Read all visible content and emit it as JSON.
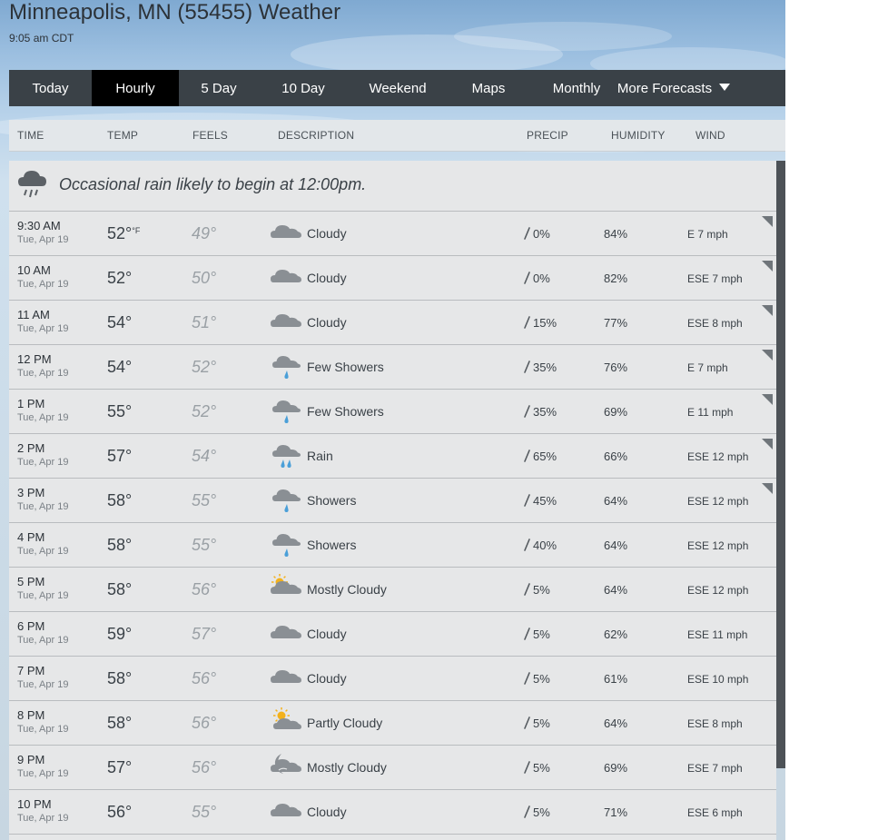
{
  "header": {
    "title": "Minneapolis, MN (55455) Weather",
    "time": "9:05 am CDT"
  },
  "nav": {
    "tabs": [
      {
        "label": "Today",
        "active": false
      },
      {
        "label": "Hourly",
        "active": true
      },
      {
        "label": "5 Day",
        "active": false
      },
      {
        "label": "10 Day",
        "active": false
      },
      {
        "label": "Weekend",
        "active": false
      },
      {
        "label": "Maps",
        "active": false
      },
      {
        "label": "Monthly",
        "active": false
      },
      {
        "label": "More Forecasts",
        "active": false,
        "dropdown": true
      }
    ]
  },
  "columns": {
    "time": "TIME",
    "temp": "TEMP",
    "feels": "FEELS",
    "description": "DESCRIPTION",
    "precip": "PRECIP",
    "humidity": "HUMIDITY",
    "wind": "WIND"
  },
  "banner": {
    "text": "Occasional rain likely to begin at 12:00pm.",
    "icon": "rain-cloud-icon"
  },
  "temp_unit": "°F",
  "rows": [
    {
      "time": "9:30 AM",
      "date": "Tue, Apr 19",
      "temp": "52°",
      "feels": "49°",
      "icon": "cloud-icon",
      "desc": "Cloudy",
      "precip": "0%",
      "humidity": "84%",
      "wind": "E 7 mph",
      "expandable": true
    },
    {
      "time": "10 AM",
      "date": "Tue, Apr 19",
      "temp": "52°",
      "feels": "50°",
      "icon": "cloud-icon",
      "desc": "Cloudy",
      "precip": "0%",
      "humidity": "82%",
      "wind": "ESE 7 mph",
      "expandable": true
    },
    {
      "time": "11 AM",
      "date": "Tue, Apr 19",
      "temp": "54°",
      "feels": "51°",
      "icon": "cloud-icon",
      "desc": "Cloudy",
      "precip": "15%",
      "humidity": "77%",
      "wind": "ESE 8 mph",
      "expandable": true
    },
    {
      "time": "12 PM",
      "date": "Tue, Apr 19",
      "temp": "54°",
      "feels": "52°",
      "icon": "showers-icon",
      "desc": "Few Showers",
      "precip": "35%",
      "humidity": "76%",
      "wind": "E 7 mph",
      "expandable": true
    },
    {
      "time": "1 PM",
      "date": "Tue, Apr 19",
      "temp": "55°",
      "feels": "52°",
      "icon": "showers-icon",
      "desc": "Few Showers",
      "precip": "35%",
      "humidity": "69%",
      "wind": "E 11 mph",
      "expandable": true
    },
    {
      "time": "2 PM",
      "date": "Tue, Apr 19",
      "temp": "57°",
      "feels": "54°",
      "icon": "rain-icon",
      "desc": "Rain",
      "precip": "65%",
      "humidity": "66%",
      "wind": "ESE 12 mph",
      "expandable": true
    },
    {
      "time": "3 PM",
      "date": "Tue, Apr 19",
      "temp": "58°",
      "feels": "55°",
      "icon": "showers-icon",
      "desc": "Showers",
      "precip": "45%",
      "humidity": "64%",
      "wind": "ESE 12 mph",
      "expandable": true
    },
    {
      "time": "4 PM",
      "date": "Tue, Apr 19",
      "temp": "58°",
      "feels": "55°",
      "icon": "showers-icon",
      "desc": "Showers",
      "precip": "40%",
      "humidity": "64%",
      "wind": "ESE 12 mph",
      "expandable": false
    },
    {
      "time": "5 PM",
      "date": "Tue, Apr 19",
      "temp": "58°",
      "feels": "56°",
      "icon": "mostly-cloudy-sun-icon",
      "desc": "Mostly Cloudy",
      "precip": "5%",
      "humidity": "64%",
      "wind": "ESE 12 mph",
      "expandable": false
    },
    {
      "time": "6 PM",
      "date": "Tue, Apr 19",
      "temp": "59°",
      "feels": "57°",
      "icon": "cloud-icon",
      "desc": "Cloudy",
      "precip": "5%",
      "humidity": "62%",
      "wind": "ESE 11 mph",
      "expandable": false
    },
    {
      "time": "7 PM",
      "date": "Tue, Apr 19",
      "temp": "58°",
      "feels": "56°",
      "icon": "cloud-icon",
      "desc": "Cloudy",
      "precip": "5%",
      "humidity": "61%",
      "wind": "ESE 10 mph",
      "expandable": false
    },
    {
      "time": "8 PM",
      "date": "Tue, Apr 19",
      "temp": "58°",
      "feels": "56°",
      "icon": "partly-cloudy-sun-icon",
      "desc": "Partly Cloudy",
      "precip": "5%",
      "humidity": "64%",
      "wind": "ESE 8 mph",
      "expandable": false
    },
    {
      "time": "9 PM",
      "date": "Tue, Apr 19",
      "temp": "57°",
      "feels": "56°",
      "icon": "mostly-cloudy-night-icon",
      "desc": "Mostly Cloudy",
      "precip": "5%",
      "humidity": "69%",
      "wind": "ESE 7 mph",
      "expandable": false
    },
    {
      "time": "10 PM",
      "date": "Tue, Apr 19",
      "temp": "56°",
      "feels": "55°",
      "icon": "cloud-icon",
      "desc": "Cloudy",
      "precip": "5%",
      "humidity": "71%",
      "wind": "ESE 6 mph",
      "expandable": false
    }
  ],
  "colors": {
    "nav_bg": "#3a4147",
    "nav_active": "#000000",
    "row_bg": "#e6e7e8",
    "rain_blue": "#4a9fd8",
    "sun_yellow": "#f3b11b"
  }
}
